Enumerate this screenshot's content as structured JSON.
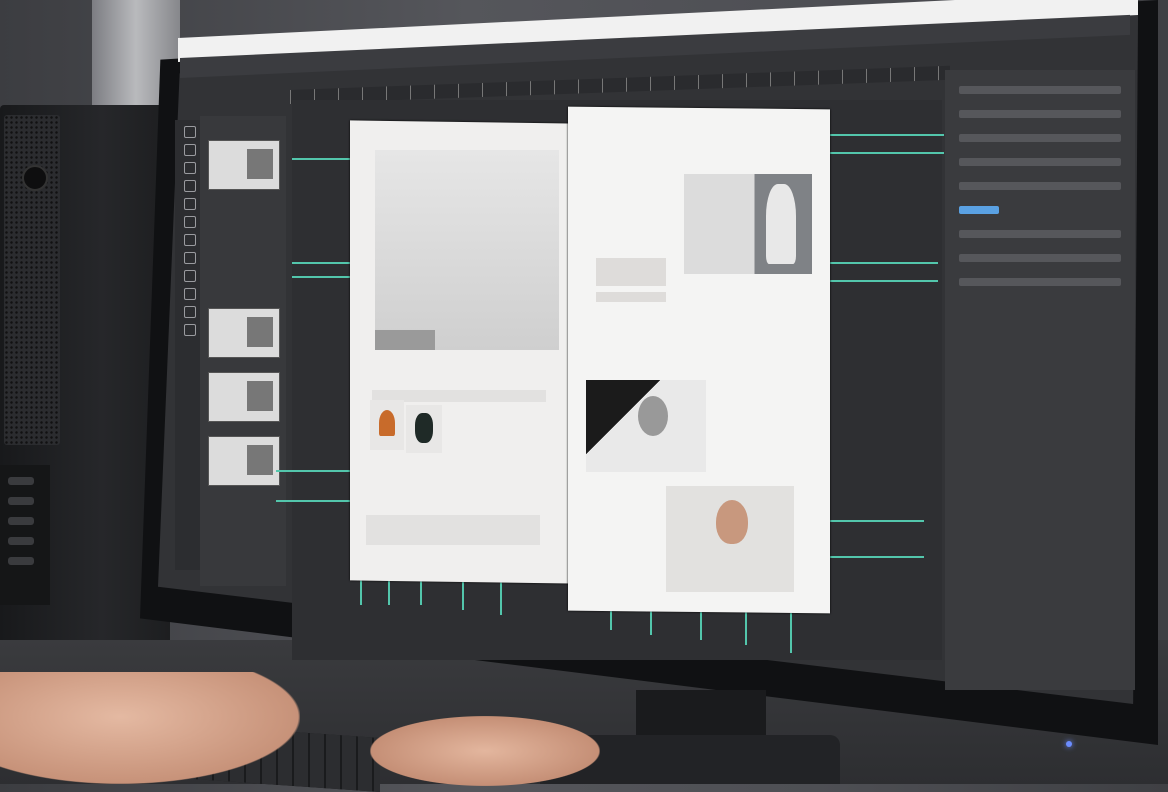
{
  "scene": {
    "description_kind": "photograph",
    "screen_app": {
      "page_label": "",
      "accent_color": "#53c6ac",
      "ui_color": "#323336",
      "highlight_field_color": "#5aa1e3"
    },
    "led_color": "#6b8cff"
  }
}
